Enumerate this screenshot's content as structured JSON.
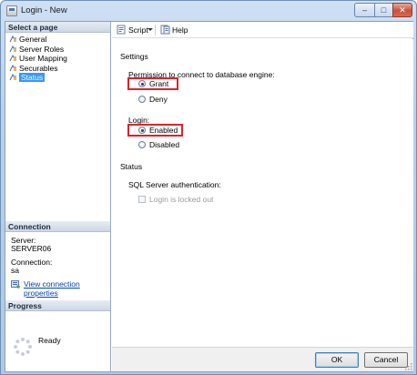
{
  "window": {
    "title": "Login - New",
    "controls": {
      "minimize": "–",
      "maximize": "□",
      "close": "✕"
    }
  },
  "left_pane": {
    "select_page_header": "Select a page",
    "pages": [
      {
        "label": "General",
        "icon": "page-icon",
        "selected": false
      },
      {
        "label": "Server Roles",
        "icon": "page-icon",
        "selected": false
      },
      {
        "label": "User Mapping",
        "icon": "page-icon",
        "selected": false
      },
      {
        "label": "Securables",
        "icon": "page-icon",
        "selected": false
      },
      {
        "label": "Status",
        "icon": "page-icon",
        "selected": true
      }
    ],
    "connection": {
      "header": "Connection",
      "server_label": "Server:",
      "server_value": "SERVER06",
      "connection_label": "Connection:",
      "connection_value": "sa",
      "view_properties_link": "View connection properties"
    },
    "progress": {
      "header": "Progress",
      "status": "Ready"
    }
  },
  "toolbar": {
    "script_label": "Script",
    "help_label": "Help"
  },
  "settings": {
    "section_title": "Settings",
    "permission_label": "Permission to connect to database engine:",
    "permission_options": [
      {
        "label": "Grant",
        "checked": true
      },
      {
        "label": "Deny",
        "checked": false
      }
    ],
    "login_label": "Login:",
    "login_options": [
      {
        "label": "Enabled",
        "checked": true
      },
      {
        "label": "Disabled",
        "checked": false
      }
    ]
  },
  "status": {
    "section_title": "Status",
    "sql_auth_label": "SQL Server authentication:",
    "locked_out_label": "Login is locked out",
    "locked_out_checked": false,
    "locked_out_enabled": false
  },
  "buttons": {
    "ok": "OK",
    "cancel": "Cancel"
  },
  "colors": {
    "highlight_box": "#d9232e",
    "selected_page": "#3399ff",
    "link": "#0645ad"
  }
}
